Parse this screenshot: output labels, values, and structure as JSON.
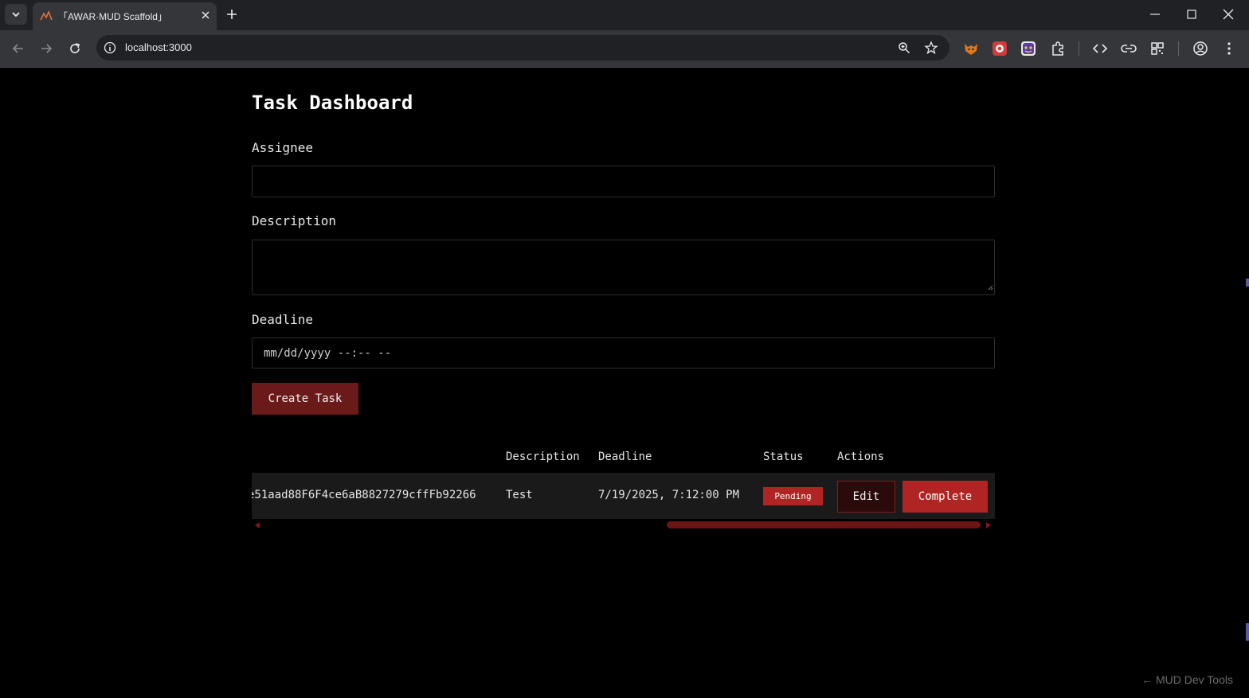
{
  "browser": {
    "tab_title": "「AWAR·MUD Scaffold」",
    "url": "localhost:3000",
    "icons": [
      "tab-list-icon",
      "close-icon",
      "plus-icon",
      "minimize-icon",
      "maximize-icon",
      "close-window-icon",
      "back-icon",
      "forward-icon",
      "reload-icon",
      "info-icon",
      "zoom-icon",
      "star-icon",
      "fox-extension-icon",
      "red-extension-icon",
      "face-extension-icon",
      "extensions-icon",
      "code-icon",
      "link-icon",
      "qr-icon",
      "profile-icon",
      "kebab-menu-icon"
    ]
  },
  "page": {
    "title": "Task Dashboard",
    "form": {
      "assignee_label": "Assignee",
      "assignee_value": "",
      "description_label": "Description",
      "description_value": "",
      "deadline_label": "Deadline",
      "deadline_placeholder": "mm/dd/yyyy --:-- --",
      "submit_label": "Create Task"
    },
    "table": {
      "headers": [
        "Description",
        "Deadline",
        "Status",
        "Actions"
      ],
      "rows": [
        {
          "assignee": "e51aad88F6F4ce6aB8827279cffFb92266",
          "description": "Test",
          "deadline": "7/19/2025, 7:12:00 PM",
          "status": "Pending",
          "edit_label": "Edit",
          "complete_label": "Complete"
        }
      ]
    },
    "devtools_label": "← MUD Dev Tools"
  },
  "colors": {
    "accent": "#b02424",
    "dark_accent": "#6b1a1a",
    "background": "#000000"
  }
}
